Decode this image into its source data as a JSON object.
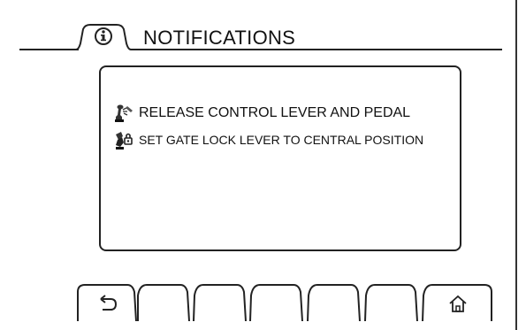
{
  "header": {
    "title": "NOTIFICATIONS",
    "icon": "info-icon"
  },
  "notifications": [
    {
      "icon": "control-lever-pedal-icon",
      "text": "RELEASE CONTROL LEVER AND PEDAL"
    },
    {
      "icon": "gate-lock-lever-icon",
      "text": "SET GATE LOCK LEVER TO CENTRAL POSITION"
    }
  ],
  "softkeys": [
    {
      "icon": "back-arrow-icon"
    },
    {
      "icon": ""
    },
    {
      "icon": ""
    },
    {
      "icon": ""
    },
    {
      "icon": ""
    },
    {
      "icon": ""
    },
    {
      "icon": "home-icon"
    }
  ],
  "colors": {
    "background": "#ffffff",
    "foreground": "#222222"
  }
}
